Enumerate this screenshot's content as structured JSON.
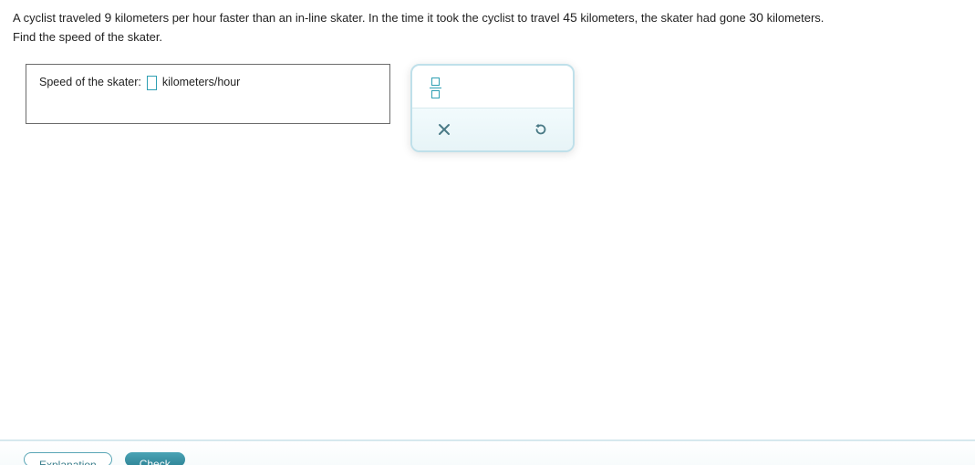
{
  "question": {
    "part1": "A cyclist traveled ",
    "num1": "9",
    "part2": " kilometers per hour faster than an in-line skater. In the time it took the cyclist to travel ",
    "num2": "45",
    "part3": " kilometers, the skater had gone ",
    "num3": "30",
    "part4": " kilometers.",
    "line2": "Find the speed of the skater."
  },
  "answer": {
    "label": "Speed of the skater:",
    "value": "",
    "units": "kilometers/hour"
  },
  "tools": {
    "fraction": "fraction",
    "clear": "×",
    "reset": "↺"
  },
  "footer": {
    "explanation": "Explanation",
    "check": "Check"
  }
}
